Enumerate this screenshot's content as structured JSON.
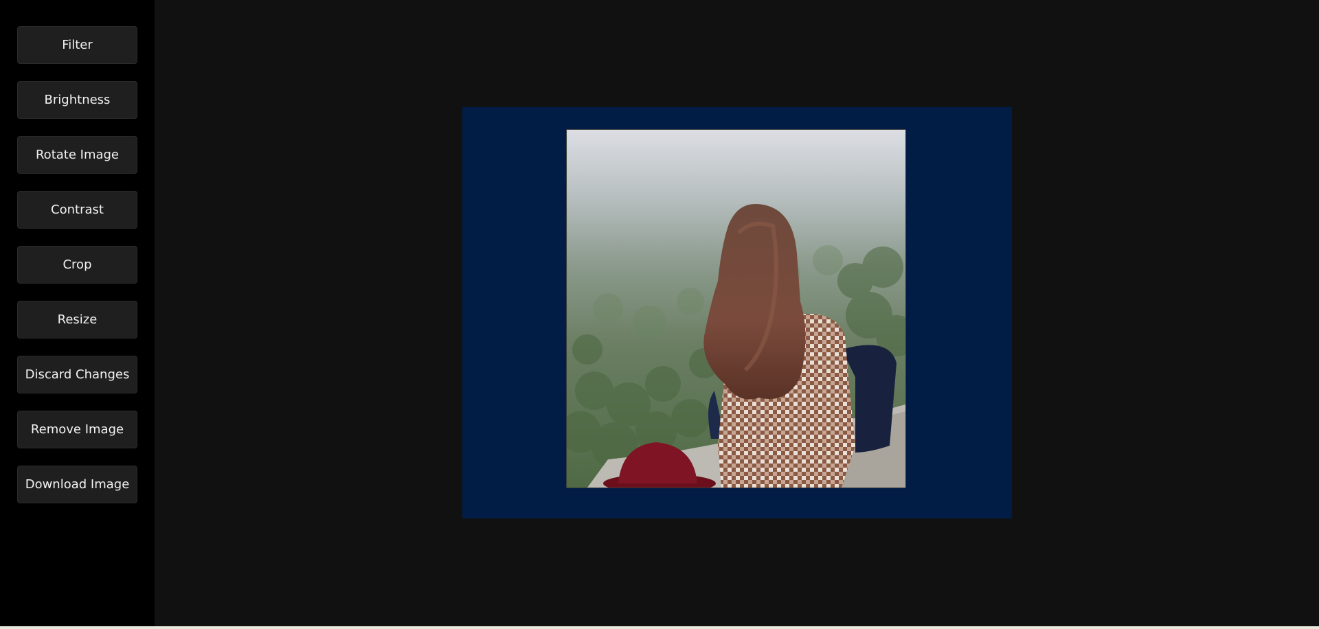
{
  "sidebar": {
    "buttons": [
      {
        "label": "Filter"
      },
      {
        "label": "Brightness"
      },
      {
        "label": "Rotate Image"
      },
      {
        "label": "Contrast"
      },
      {
        "label": "Crop"
      },
      {
        "label": "Resize"
      },
      {
        "label": "Discard Changes"
      },
      {
        "label": "Remove Image"
      },
      {
        "label": "Download Image"
      }
    ]
  },
  "canvas": {
    "frame_color": "#021d45",
    "image_subject": "woman-on-rock-overlooking-forest"
  }
}
